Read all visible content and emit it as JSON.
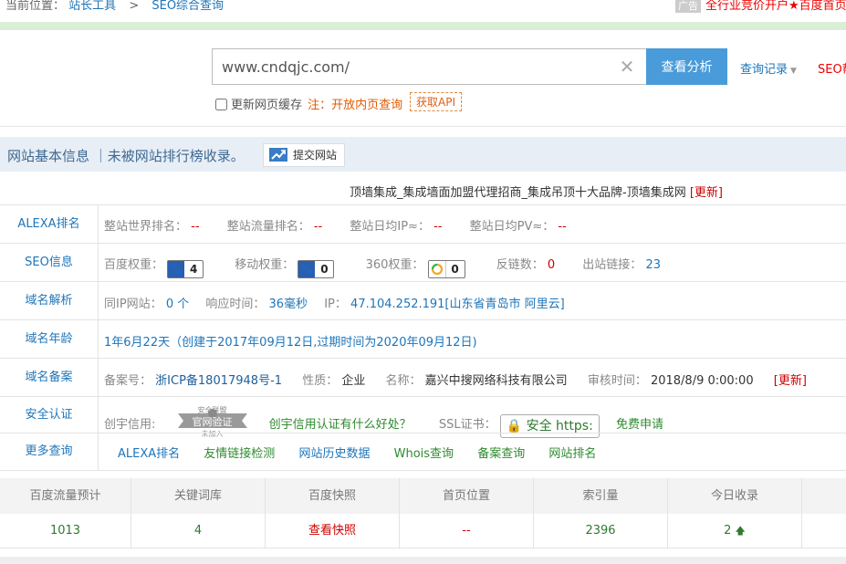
{
  "breadcrumb": {
    "prefix": "当前位置：",
    "home": "站长工具",
    "separator": ">",
    "current": "SEO综合查询"
  },
  "top_ad": {
    "tag": "广告",
    "text": "全行业竞价开户★百度首页"
  },
  "search": {
    "value": "www.cndqjc.com/",
    "clear_icon": "close-icon",
    "button": "查看分析",
    "history": "查询记录",
    "extra_link": "SEO帮"
  },
  "options": {
    "refresh_cache": "更新网页缓存",
    "note": "注：开放内页查询",
    "api": "获取API"
  },
  "info": {
    "title": "网站基本信息 ｜未被网站排行榜收录。",
    "submit": "提交网站"
  },
  "site_title": "顶墙集成_集成墙面加盟代理招商_集成吊顶十大品牌-顶墙集成网",
  "update_label": "[更新]",
  "rows": {
    "alexa": {
      "label": "ALEXA排名",
      "world_k": "整站世界排名：",
      "world_v": "--",
      "flow_k": "整站流量排名：",
      "flow_v": "--",
      "ip_k": "整站日均IP≈：",
      "ip_v": "--",
      "pv_k": "整站日均PV≈：",
      "pv_v": "--"
    },
    "seo": {
      "label": "SEO信息",
      "baidu_k": "百度权重：",
      "baidu_v": "4",
      "mobile_k": "移动权重：",
      "mobile_v": "0",
      "s360_k": "360权重：",
      "s360_v": "0",
      "backlinks_k": "反链数：",
      "backlinks_v": "0",
      "outlinks_k": "出站链接：",
      "outlinks_v": "23"
    },
    "dns": {
      "label": "域名解析",
      "sameip_k": "同IP网站：",
      "sameip_v": "0 个",
      "resp_k": "响应时间：",
      "resp_v": "36毫秒",
      "ip_k": "IP：",
      "ip_v": "47.104.252.191[山东省青岛市 阿里云]"
    },
    "age": {
      "label": "域名年龄",
      "value": "1年6月22天（创建于2017年09月12日,过期时间为2020年09月12日)"
    },
    "icp": {
      "label": "域名备案",
      "no_k": "备案号：",
      "no_v": "浙ICP备18017948号-1",
      "type_k": "性质：",
      "type_v": "企业",
      "name_k": "名称：",
      "name_v": "嘉兴中搜网络科技有限公司",
      "time_k": "审核时间：",
      "time_v": "2018/8/9 0:00:00"
    },
    "security": {
      "label": "安全认证",
      "credit_k": "创宇信用:",
      "seal_top": "安全联盟",
      "seal_main": "官网验证",
      "seal_sub": "未加入",
      "credit_link": "创宇信用认证有什么好处？",
      "ssl_k": "SSL证书：",
      "ssl_badge": "安全 https:",
      "ssl_apply": "免费申请"
    },
    "more": {
      "label": "更多查询",
      "links": [
        "ALEXA排名",
        "友情链接检测",
        "网站历史数据",
        "Whois查询",
        "备案查询",
        "网站排名"
      ]
    }
  },
  "stats": {
    "headers": [
      "百度流量预计",
      "关键词库",
      "百度快照",
      "首页位置",
      "索引量",
      "今日收录"
    ],
    "values": [
      "1013",
      "4",
      "查看快照",
      "--",
      "2396",
      "2"
    ]
  }
}
